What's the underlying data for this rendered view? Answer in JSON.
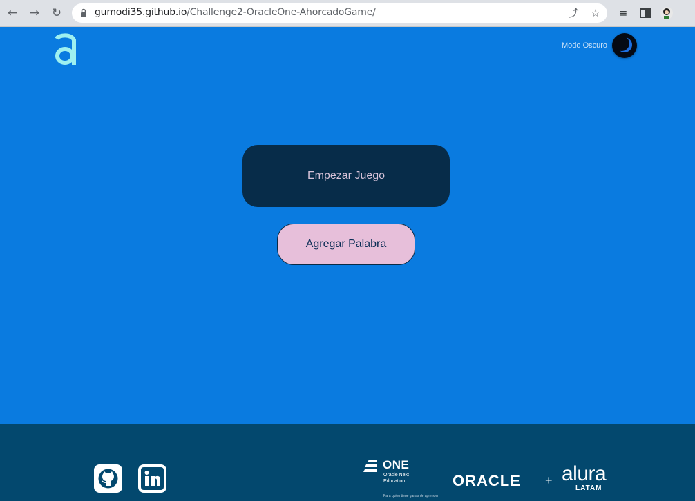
{
  "browser": {
    "back_icon": "arrow-left-icon",
    "forward_icon": "arrow-right-icon",
    "reload_icon": "reload-icon",
    "url_host": "gumodi35.github.io",
    "url_path": "/Challenge2-OracleOne-AhorcadoGame/"
  },
  "header": {
    "logo_icon": "alura-a-logo",
    "dark_mode_label": "Modo Oscuro",
    "dark_mode_icon": "moon-icon"
  },
  "main": {
    "start_button_label": "Empezar Juego",
    "add_word_button_label": "Agregar Palabra"
  },
  "footer": {
    "github_icon": "github-icon",
    "linkedin_icon": "linkedin-icon",
    "one_title": "ONE",
    "one_subtitle": "Oracle Next Education",
    "one_tagline": "Para quien tiene ganas de aprender",
    "oracle_label": "ORACLE",
    "plus_label": "+",
    "alura_label": "alura",
    "latam_label": "LATAM"
  },
  "colors": {
    "page_bg": "#0a7be0",
    "footer_bg": "#03486e",
    "start_button_bg": "#072c49",
    "add_button_bg": "#e7bfda",
    "logo_color": "#9ef0f0"
  }
}
